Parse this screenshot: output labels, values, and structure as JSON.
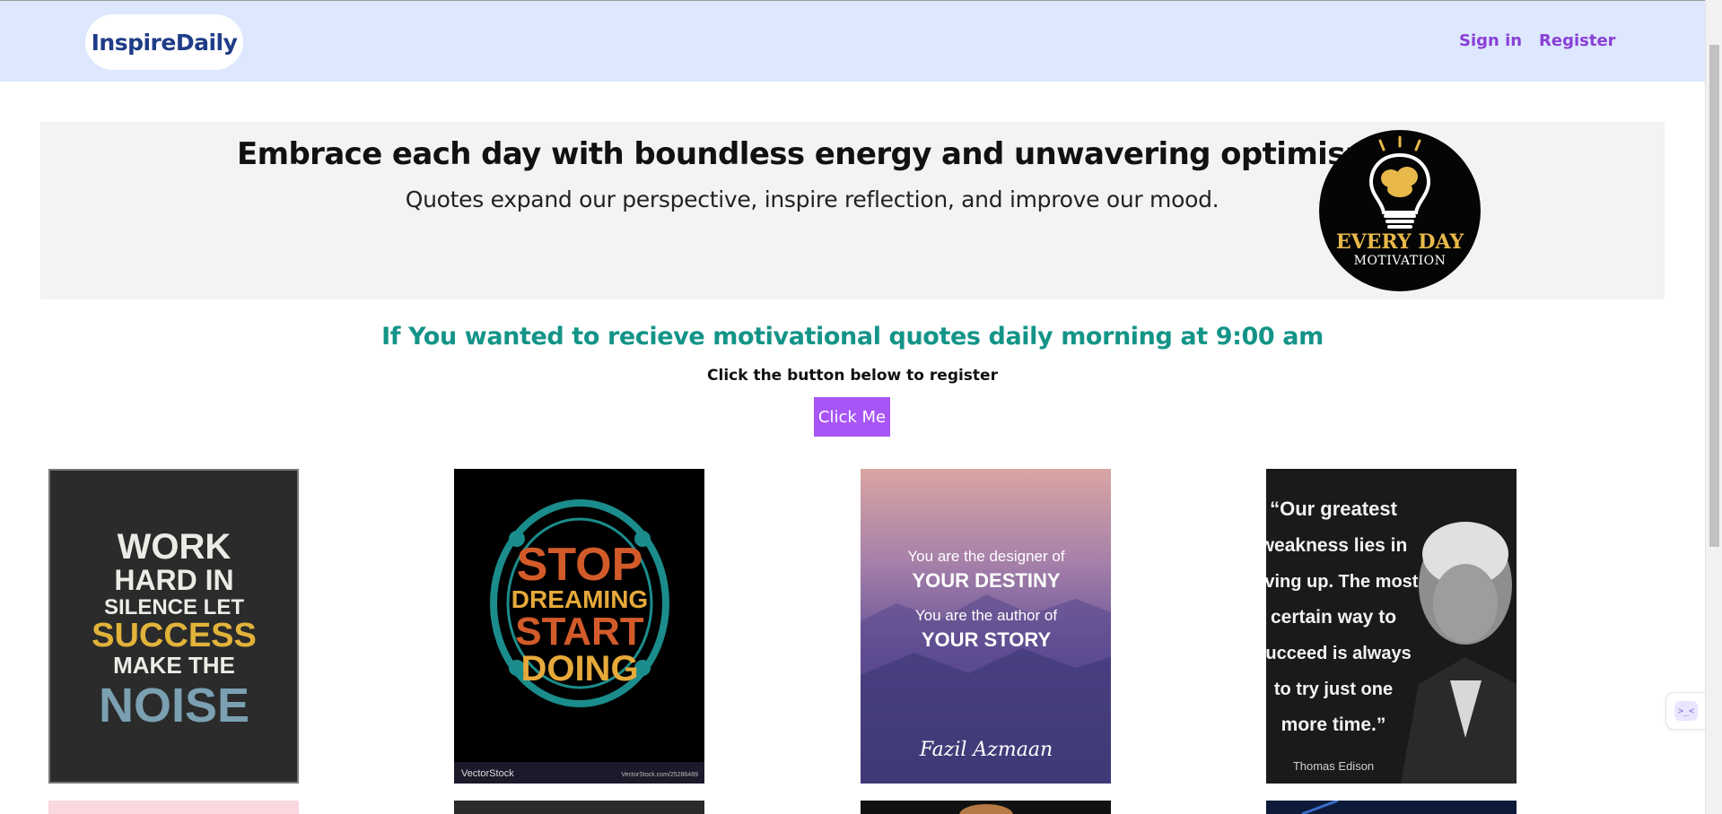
{
  "nav": {
    "brand": "InspireDaily",
    "links": [
      "Sign in",
      "Register"
    ]
  },
  "hero": {
    "title": "Embrace each day with boundless energy and unwavering optimism.",
    "subtitle": "Quotes expand our perspective, inspire reflection, and improve our mood.",
    "logo_line1": "EVERY DAY",
    "logo_line2": "MOTIVATION"
  },
  "cta": {
    "title": "If You wanted to recieve motivational quotes daily morning at 9:00 am",
    "subtitle": "Click the button below to register",
    "button": "Click Me"
  },
  "quotes": [
    {
      "lines": [
        "WORK",
        "HARD IN",
        "SILENCE LET",
        "SUCCESS",
        "MAKE THE",
        "NOISE"
      ]
    },
    {
      "lines": [
        "STOP",
        "DREAMING",
        "START",
        "DOING"
      ],
      "watermark_left": "VectorStock",
      "watermark_right": "VectorStock.com/25286489"
    },
    {
      "lines": [
        "You are the designer of",
        "YOUR DESTINY",
        "You are the author of",
        "YOUR STORY"
      ],
      "author": "Fazil Azmaan"
    },
    {
      "lines": [
        "“Our greatest",
        "weakness lies in",
        "giving up. The most",
        "certain way to",
        "succeed is always",
        "to try just one",
        "more time.”"
      ],
      "author": "Thomas Edison"
    }
  ],
  "helper": {
    "label": ">_<"
  },
  "colors": {
    "nav_bg": "#dde8ff",
    "brand": "#1f3c88",
    "link": "#8a3fd6",
    "hero_bg": "#f3f3f3",
    "cta_title": "#149488",
    "button": "#a855f7"
  }
}
